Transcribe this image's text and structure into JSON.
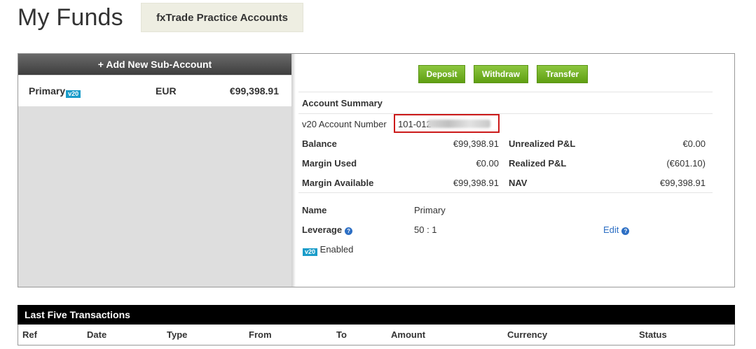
{
  "page": {
    "title": "My Funds",
    "practice_badge": "fxTrade Practice Accounts"
  },
  "sidebar": {
    "add_label": "+ Add New Sub-Account",
    "accounts": [
      {
        "name": "Primary",
        "badge": "v20",
        "currency": "EUR",
        "balance": "€99,398.91"
      }
    ]
  },
  "actions": {
    "deposit": "Deposit",
    "withdraw": "Withdraw",
    "transfer": "Transfer"
  },
  "summary": {
    "title": "Account Summary",
    "account_number_label": "v20 Account Number",
    "account_number_visible": "101-012",
    "balance_label": "Balance",
    "balance_value": "€99,398.91",
    "margin_used_label": "Margin Used",
    "margin_used_value": "€0.00",
    "margin_available_label": "Margin Available",
    "margin_available_value": "€99,398.91",
    "unrealized_label": "Unrealized P&L",
    "unrealized_value": "€0.00",
    "realized_label": "Realized P&L",
    "realized_value": "(€601.10)",
    "nav_label": "NAV",
    "nav_value": "€99,398.91"
  },
  "details": {
    "name_label": "Name",
    "name_value": "Primary",
    "leverage_label": "Leverage",
    "leverage_value": "50 : 1",
    "edit_label": "Edit",
    "v20_badge": "v20",
    "enabled_label": "Enabled"
  },
  "transactions": {
    "title": "Last Five Transactions",
    "columns": [
      "Ref",
      "Date",
      "Type",
      "From",
      "To",
      "Amount",
      "Currency",
      "Status"
    ]
  },
  "colors": {
    "button_green": "#6fb31f",
    "highlight_red": "#cc1a1a",
    "link_blue": "#2d6fc4",
    "v20_blue": "#1a9cc9"
  }
}
